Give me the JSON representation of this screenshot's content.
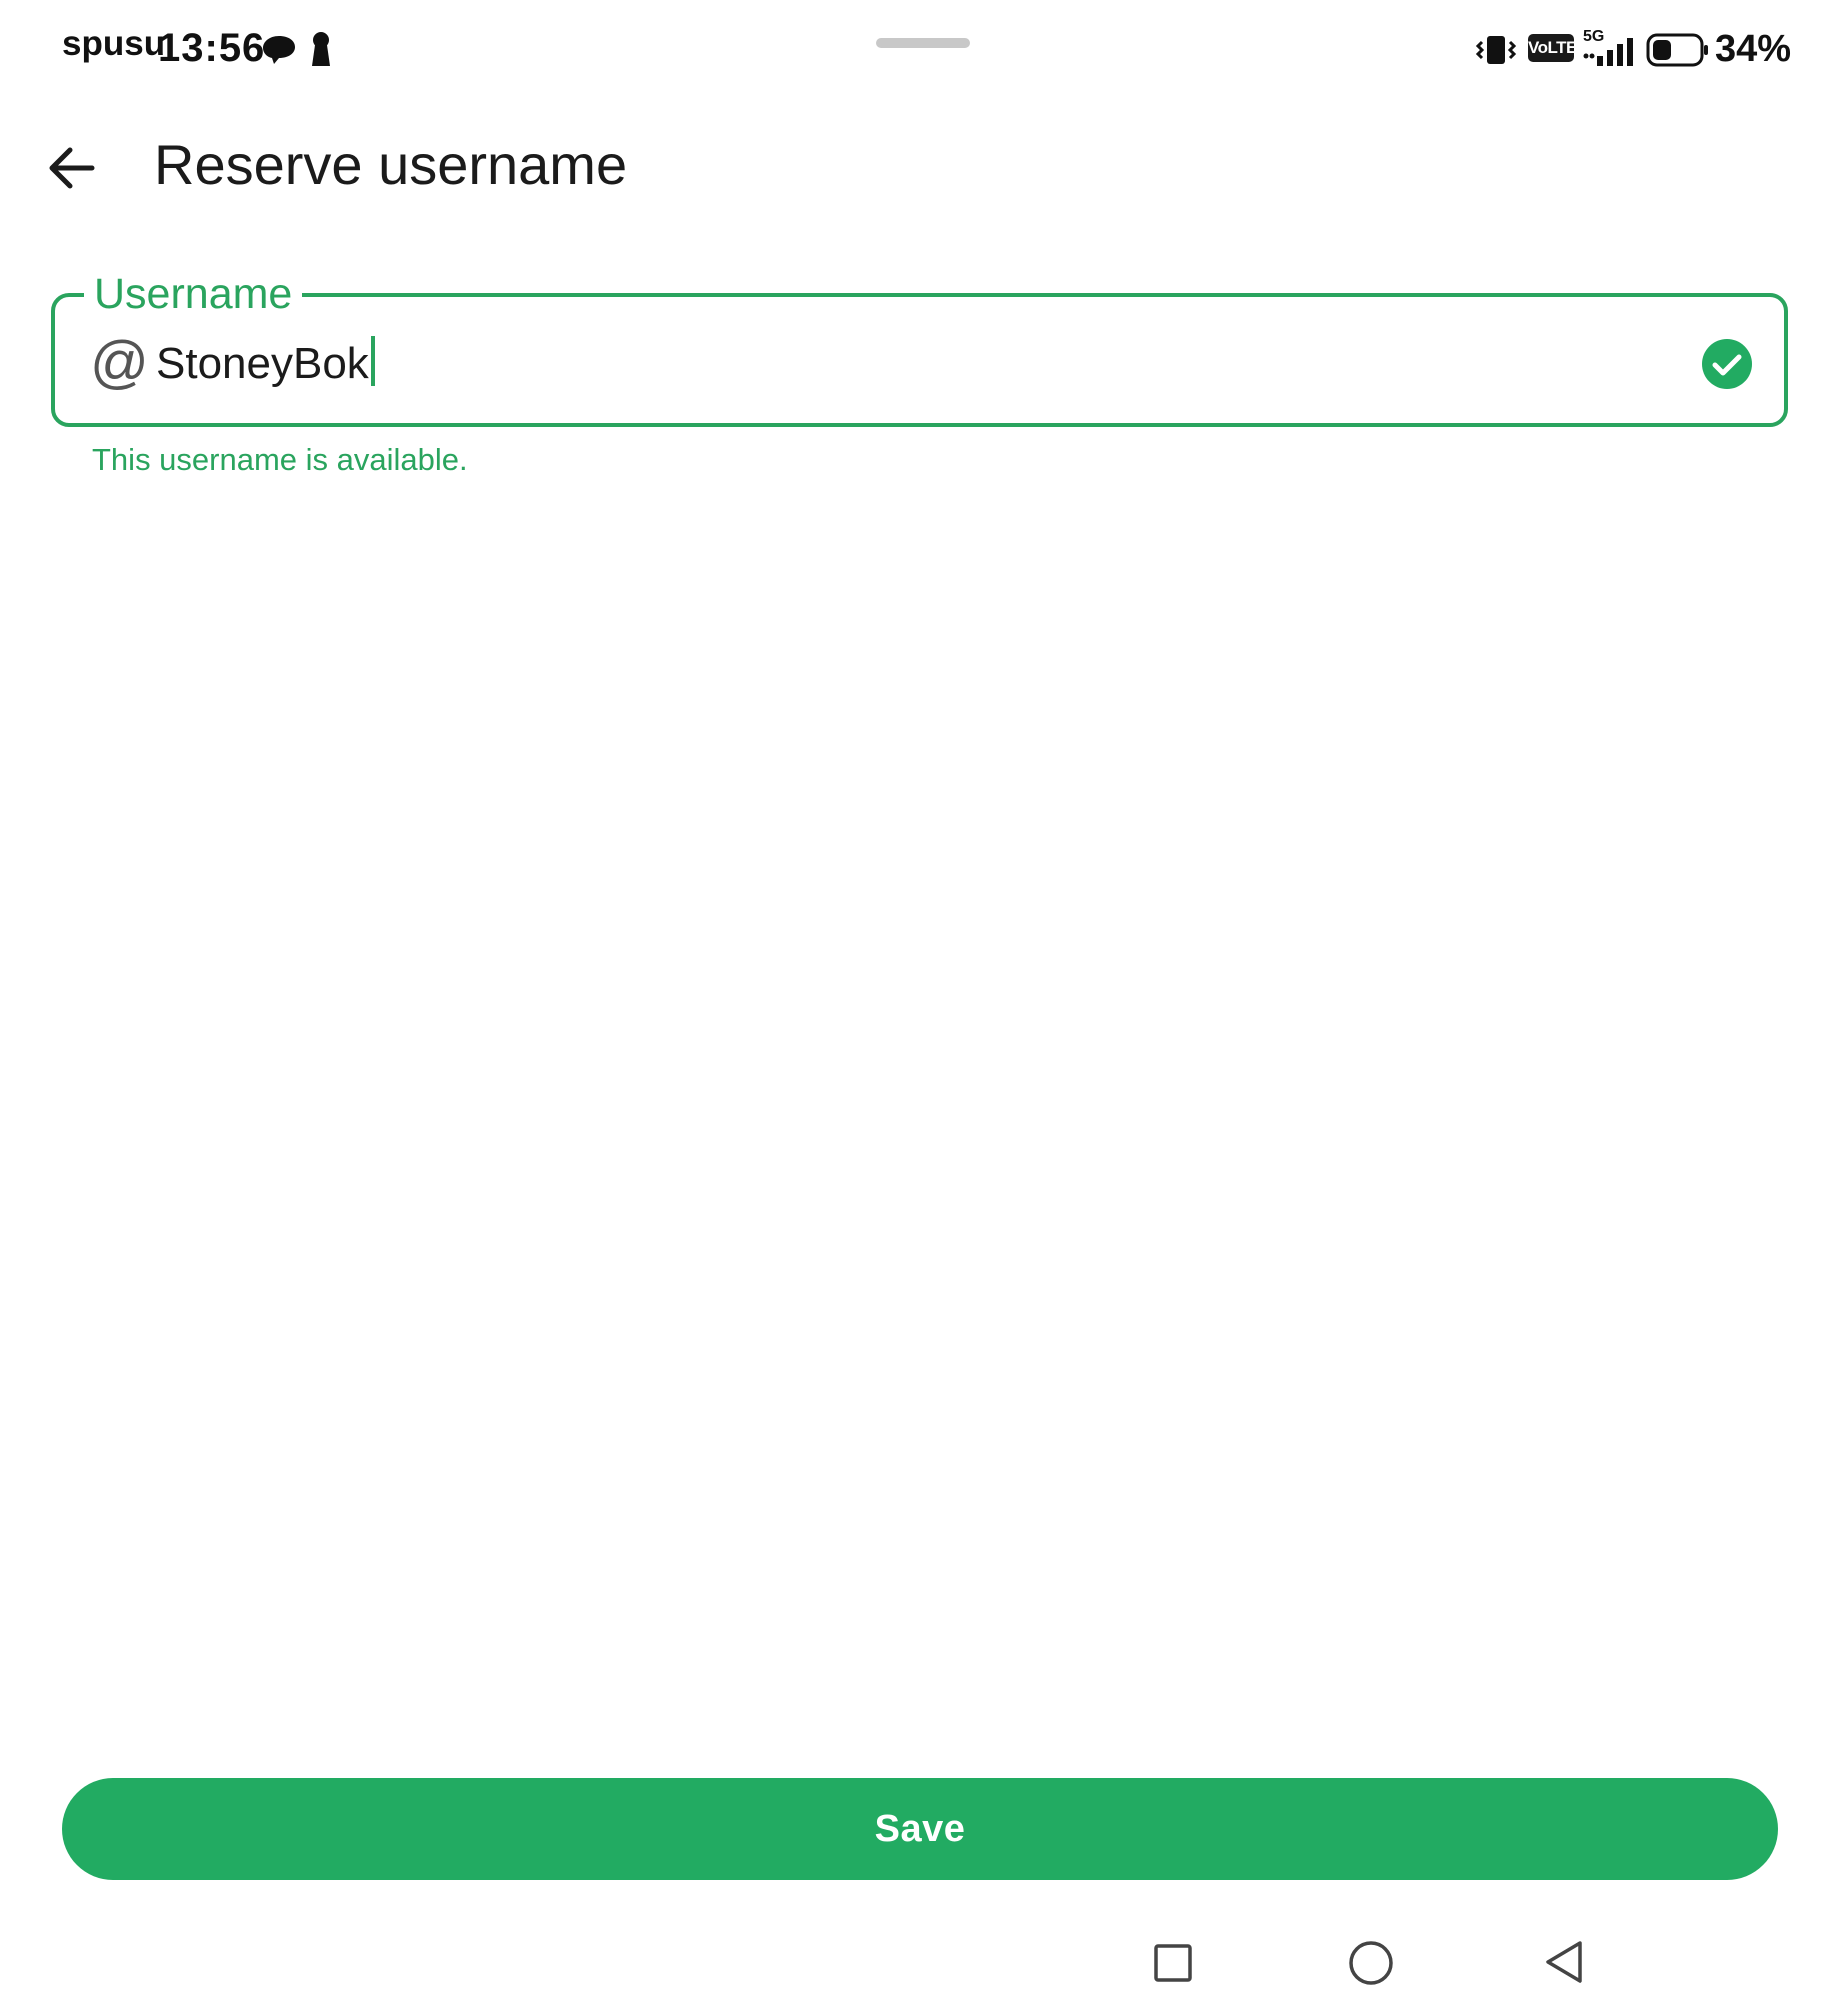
{
  "status_bar": {
    "carrier": "spusu",
    "time": "13:56",
    "icons": [
      "chat-icon",
      "keyhole-icon",
      "vibrate-icon",
      "volte-icon",
      "signal-icon",
      "battery-icon"
    ],
    "volte_label": "VoLTE",
    "network_type": "5G",
    "battery_level": "34%"
  },
  "app_bar": {
    "title": "Reserve username",
    "back_icon": "arrow-left-icon"
  },
  "username_field": {
    "label": "Username",
    "prefix": "@",
    "value": "StoneyBok",
    "helper_text": "This username is available.",
    "status_icon": "check-circle-icon"
  },
  "actions": {
    "save_label": "Save"
  },
  "nav_bar": {
    "buttons": [
      "recents-icon",
      "home-icon",
      "back-icon"
    ]
  },
  "colors": {
    "accent": "#2aa45e",
    "button": "#22ab62",
    "text": "#1b1b1b"
  }
}
